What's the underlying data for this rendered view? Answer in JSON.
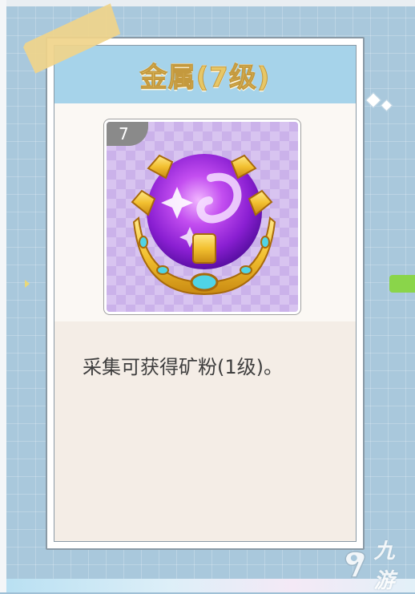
{
  "card": {
    "title": "金属(7级)",
    "level": "7",
    "description": "采集可获得矿粉(1级)。"
  },
  "item_icon": "purple-crystal-orb-in-gold-crown-icon",
  "watermark": {
    "text": "九游",
    "logo_icon": "9you-logo-icon"
  },
  "colors": {
    "header": "#a6d3ea",
    "title": "#e7c766",
    "card_body": "#f4ede6",
    "badge": "#8a8a8a",
    "background": "#a9c8dc"
  }
}
